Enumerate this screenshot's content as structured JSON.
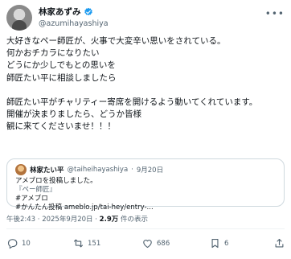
{
  "author": {
    "display_name": "林家あずみ",
    "handle": "@azumihayashiya",
    "verified_color": "#1d9bf0"
  },
  "post": {
    "lines": [
      "大好きなペー師匠が、火事で大変辛い思いをされている。",
      "何かおチカラになりたい",
      "どうにか少しでもとの思いを",
      "師匠たい平に相談しましたら",
      "",
      "師匠たい平がチャリティー寄席を開けるよう動いてくれています。",
      "開催が決まりましたら、どうか皆様",
      "観に来てくださいませ！！！"
    ]
  },
  "quote": {
    "display_name": "林家たい平",
    "handle": "@taiheihayashiya",
    "date": "9月20日",
    "lines": [
      "アメブロを投稿しました。",
      "『ペー師匠』",
      "#アメブロ",
      "#かんたん投稿 ameblo.jp/tai-hey/entry-..."
    ]
  },
  "meta": {
    "time": "午後2:43",
    "date": "2025年9月20日",
    "views": "2.9万",
    "views_suffix": "件の表示"
  },
  "actions": {
    "replies": "10",
    "reposts": "151",
    "likes": "686",
    "bookmarks": "6"
  },
  "icons": {
    "reply": "reply-icon",
    "repost": "repost-icon",
    "like": "heart-icon",
    "bookmark": "bookmark-icon",
    "share": "share-icon",
    "more": "more-icon"
  }
}
